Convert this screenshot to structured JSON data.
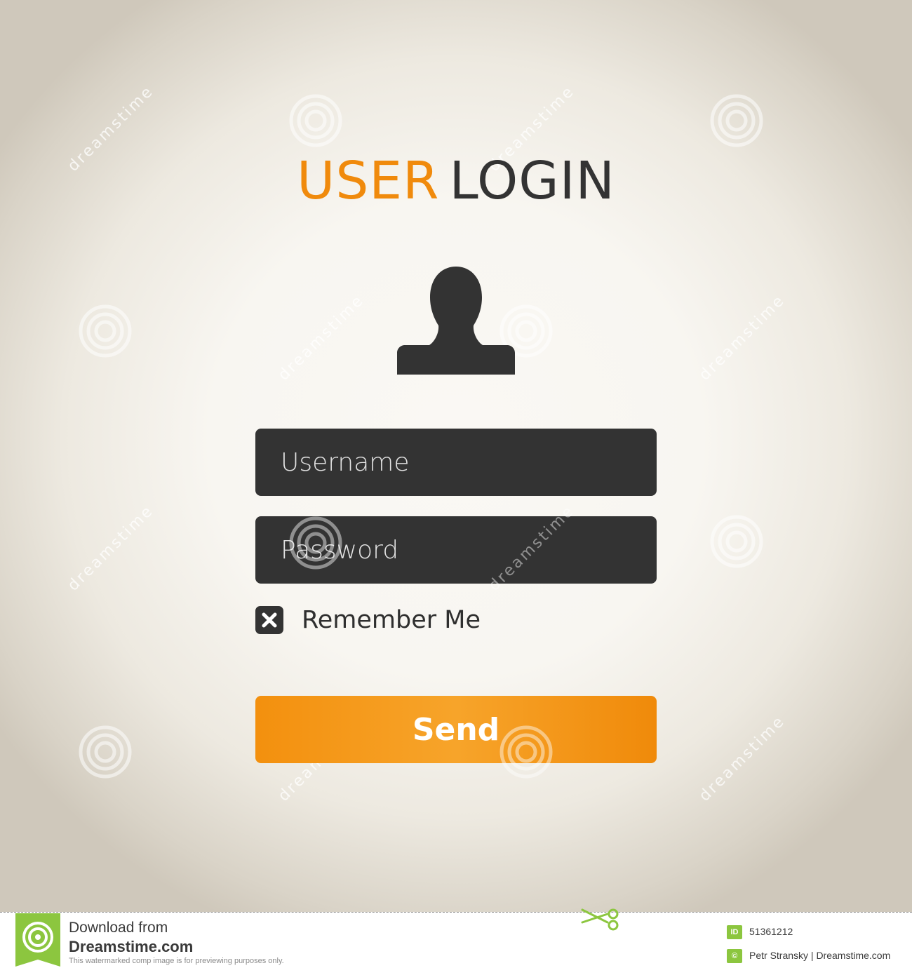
{
  "title": {
    "part1": "USER",
    "part2": "LOGIN"
  },
  "avatar": {
    "icon": "user-silhouette-icon"
  },
  "form": {
    "username_placeholder": "Username",
    "password_placeholder": "Password",
    "remember_label": "Remember Me",
    "remember_checked": true,
    "send_label": "Send"
  },
  "watermark": {
    "text": "dreamstime"
  },
  "footer": {
    "download_text": "Download from",
    "brand_text": "Dreamstime.com",
    "note_text": "This watermarked comp image is for previewing purposes only.",
    "id_badge": "ID",
    "id_value": "51361212",
    "copyright_symbol": "©",
    "author": "Petr Stransky | Dreamstime.com"
  },
  "colors": {
    "accent": "#f08a0c",
    "dark": "#333333",
    "background": "#f8f6f1",
    "footer_green": "#8cc63f"
  }
}
